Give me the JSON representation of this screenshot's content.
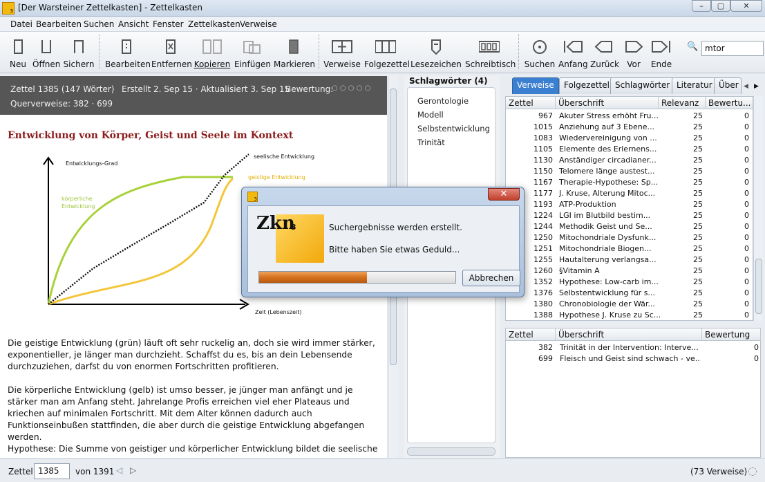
{
  "window": {
    "title": "[Der Warsteiner Zettelkasten] - Zettelkasten",
    "app_icon_label": "3",
    "minimize": "–",
    "maximize": "▢",
    "close": "✕"
  },
  "menu": [
    "Datei",
    "Bearbeiten",
    "Suchen",
    "Ansicht",
    "Fenster",
    "Zettelkasten",
    "Verweise"
  ],
  "toolbar": {
    "neu": "Neu",
    "oeffnen": "Öffnen",
    "sichern": "Sichern",
    "bearbeiten": "Bearbeiten",
    "entfernen": "Entfernen",
    "kopieren": "Kopieren",
    "einfuegen": "Einfügen",
    "markieren": "Markieren",
    "verweise": "Verweise",
    "folgezettel": "Folgezettel",
    "lesezeichen": "Lesezeichen",
    "schreibtisch": "Schreibtisch",
    "suchen": "Suchen",
    "anfang": "Anfang",
    "zurueck": "Zurück",
    "vor": "Vor",
    "ende": "Ende",
    "search_value": "mtor"
  },
  "note": {
    "header": "Zettel 1385 (147 Wörter)",
    "created": "Erstellt 2. Sep 15 · Aktualisiert 3. Sep 15",
    "rating_label": "Bewertung:",
    "rating_dots": "○ ○ ○ ○ ○",
    "crossrefs": "Querverweise: 382 · 699",
    "title": "Entwicklung von Körper, Geist und Seele im Kontext",
    "figure": {
      "ylabel": "Entwicklungs-Grad",
      "xlabel": "Zeit (Lebenszeit)",
      "series_seelisch": "seelische Entwicklung",
      "series_geistig": "geistige Entwicklung",
      "series_koerperlich_1": "körperliche",
      "series_koerperlich_2": "Entwicklung"
    },
    "p1": "Die geistige Entwicklung (grün) läuft oft sehr ruckelig an, doch sie wird immer stärker, exponentieller, je länger man durchzieht. Schaffst du es, bis an dein Lebensende durchzuziehen, darfst du von enormen Fortschritten profitieren.",
    "p2": "Die körperliche Entwicklung (gelb) ist umso besser, je jünger man anfängt und je stärker man am Anfang steht. Jahrelange Profis erreichen viel eher Plateaus und kriechen auf minimalen Fortschritt. Mit dem Alter können dadurch auch Funktionseinbußen stattfinden, die aber durch die geistige Entwicklung abgefangen werden.",
    "p3": "Hypothese: Die Summe von geistiger und körperlicher Entwicklung bildet die seelische"
  },
  "keywords": {
    "header": "Schlagwörter (4)",
    "items": [
      "Gerontologie",
      "Modell",
      "Selbstentwicklung",
      "Trinität"
    ]
  },
  "tabs": [
    "Verweise",
    "Folgezettel",
    "Schlagwörter",
    "Literatur",
    "Über"
  ],
  "table1": {
    "headers": [
      "Zettel",
      "Überschrift",
      "Relevanz",
      "Bewertu..."
    ],
    "rows": [
      [
        "967",
        "Akuter Stress erhöht Fru...",
        "25",
        "0"
      ],
      [
        "1015",
        "Anziehung auf 3 Ebene...",
        "25",
        "0"
      ],
      [
        "1083",
        "Wiedervereinigung von ...",
        "25",
        "0"
      ],
      [
        "1105",
        "Elemente des Erlernens...",
        "25",
        "0"
      ],
      [
        "1130",
        "Anständiger circadianer...",
        "25",
        "0"
      ],
      [
        "1150",
        "Telomere länge austest...",
        "25",
        "0"
      ],
      [
        "1167",
        "Therapie-Hypothese: Sp...",
        "25",
        "0"
      ],
      [
        "1177",
        "J. Kruse, Alterung Mitoc...",
        "25",
        "0"
      ],
      [
        "1193",
        "ATP-Produktion",
        "25",
        "0"
      ],
      [
        "1224",
        "LGI im Blutbild bestim...",
        "25",
        "0"
      ],
      [
        "1244",
        "Methodik Geist und Se...",
        "25",
        "0"
      ],
      [
        "1250",
        "Mitochondriale Dysfunk...",
        "25",
        "0"
      ],
      [
        "1251",
        "Mitochondriale Biogen...",
        "25",
        "0"
      ],
      [
        "1255",
        "Hautalterung verlangsa...",
        "25",
        "0"
      ],
      [
        "1260",
        "§Vitamin A",
        "25",
        "0"
      ],
      [
        "1352",
        "Hypothese: Low-carb im...",
        "25",
        "0"
      ],
      [
        "1376",
        "Selbstentwicklung für s...",
        "25",
        "0"
      ],
      [
        "1380",
        "Chronobiologie der Wär...",
        "25",
        "0"
      ],
      [
        "1388",
        "Hypothese J. Kruse zu Sc...",
        "25",
        "0"
      ]
    ]
  },
  "table2": {
    "headers": [
      "Zettel",
      "Überschrift",
      "Bewertung"
    ],
    "rows": [
      [
        "382",
        "Trinität in der Intervention: Interve...",
        "0"
      ],
      [
        "699",
        "Fleisch und Geist sind schwach - ve...",
        "0"
      ]
    ]
  },
  "statusbar": {
    "label": "Zettel",
    "value": "1385",
    "of": "von 1391",
    "count": "(73 Verweise)"
  },
  "dialog": {
    "logo": "Zkn",
    "logo_sub": "3",
    "msg1": "Suchergebnisse werden erstellt.",
    "msg2": "Bitte haben Sie etwas Geduld...",
    "progress": 0.55,
    "abort": "Abbrechen"
  }
}
